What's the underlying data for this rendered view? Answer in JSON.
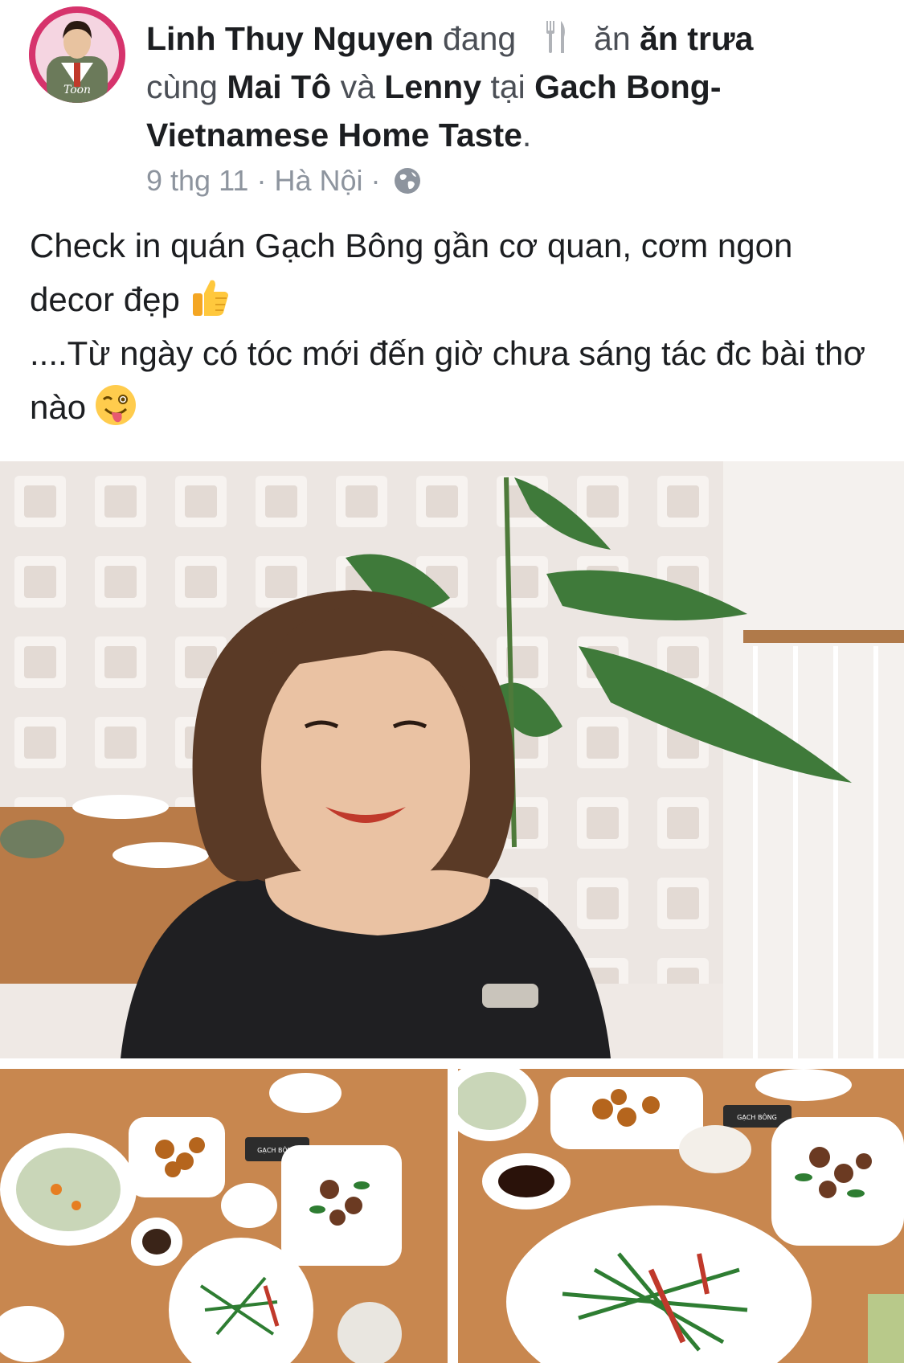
{
  "author": {
    "name": "Linh Thuy Nguyen",
    "avatar_text": "Toon"
  },
  "activity": {
    "verb": "đang",
    "activity_icon": "cutlery-icon",
    "activity_plain": "ăn",
    "activity_bold": "ăn trưa",
    "with_word": "cùng",
    "friend1": "Mai Tô",
    "and_word": "và",
    "friend2": "Lenny",
    "at_word": "tại",
    "place": "Gach Bong-Vietnamese Home Taste",
    "period": "."
  },
  "meta": {
    "date": "9 thg 11",
    "location": "Hà Nội",
    "separator": "·",
    "audience_icon": "globe-icon"
  },
  "post_text": {
    "line1": "Check in quán Gạch Bông gần cơ quan, cơm ngon decor đẹp",
    "emoji1": "thumbs-up-icon",
    "line2": "....Từ ngày có tóc mới đến giờ chưa sáng tác đc bài thơ nào",
    "emoji2": "winking-tongue-icon"
  },
  "photos": {
    "main": {
      "name": "portrait-photo"
    },
    "food_left": {
      "name": "food-table-photo-1",
      "card_text": "GẠCH BÔNG"
    },
    "food_right": {
      "name": "food-table-photo-2",
      "card_text": "GẠCH BÔNG"
    }
  },
  "colors": {
    "name": "#1c1e21",
    "muted": "#8d949e",
    "avatar_ring": "#d6336c"
  }
}
